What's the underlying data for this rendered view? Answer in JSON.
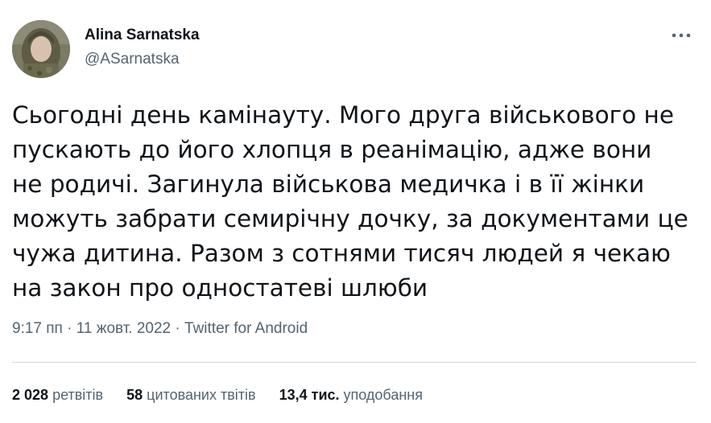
{
  "author": {
    "name": "Alina Sarnatska",
    "handle": "@ASarnatska"
  },
  "tweet": {
    "text": "Сьогодні день камінауту. Мого друга військового не\nпускають до його хлопця в реанімацію, адже вони\nне родичі. Загинула військова медичка і в її жінки\nможуть забрати семирічну дочку, за документами це\nчужа дитина. Разом з сотнями тисяч людей я чекаю\nна закон про одностатеві шлюби"
  },
  "meta": {
    "time": "9:17 пп",
    "separator": " · ",
    "date": "11 жовт. 2022",
    "source": "Twitter for Android"
  },
  "stats": {
    "retweets_count": "2 028",
    "retweets_label": "ретвітів",
    "quotes_count": "58",
    "quotes_label": "цитованих твітів",
    "likes_count": "13,4 тис.",
    "likes_label": "уподобання"
  },
  "icons": {
    "more": "more-dots-icon",
    "avatar": "avatar"
  },
  "colors": {
    "text": "#0f1419",
    "secondary": "#536471",
    "divider": "#cfd9de"
  }
}
